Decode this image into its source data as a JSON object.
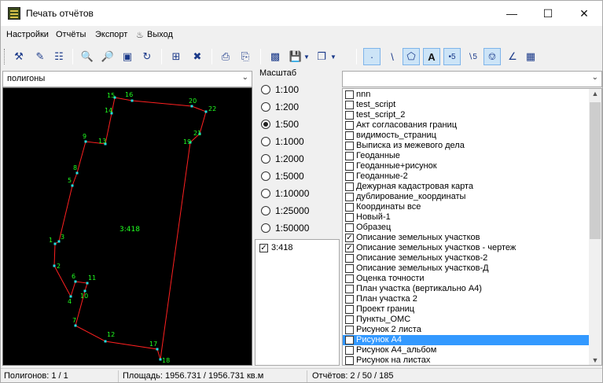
{
  "window": {
    "title": "Печать отчётов"
  },
  "menu": [
    "Настройки",
    "Отчёты",
    "Экспорт",
    "Выход"
  ],
  "layer_combo": {
    "value": "полигоны"
  },
  "map": {
    "polygon_label": "3:418",
    "points": [
      "1",
      "2",
      "3",
      "4",
      "5",
      "6",
      "7",
      "8",
      "9",
      "10",
      "11",
      "12",
      "13",
      "14",
      "15",
      "16",
      "17",
      "18",
      "19",
      "20",
      "21",
      "22"
    ]
  },
  "scale": {
    "title": "Масштаб",
    "options": [
      "1:100",
      "1:200",
      "1:500",
      "1:1000",
      "1:2000",
      "1:5000",
      "1:10000",
      "1:25000",
      "1:50000"
    ],
    "selected": "1:500"
  },
  "objects": [
    {
      "label": "3:418",
      "checked": true
    }
  ],
  "reports": [
    {
      "label": "nnn",
      "checked": false
    },
    {
      "label": "test_script",
      "checked": false
    },
    {
      "label": "test_script_2",
      "checked": false
    },
    {
      "label": "Акт согласования границ",
      "checked": false
    },
    {
      "label": "видимость_страниц",
      "checked": false
    },
    {
      "label": "Выписка из межевого дела",
      "checked": false
    },
    {
      "label": "Геоданные",
      "checked": false
    },
    {
      "label": "Геоданные+рисунок",
      "checked": false
    },
    {
      "label": "Геоданные-2",
      "checked": false
    },
    {
      "label": "Дежурная кадастровая карта",
      "checked": false
    },
    {
      "label": "дублирование_координаты",
      "checked": false
    },
    {
      "label": "Координаты все",
      "checked": false
    },
    {
      "label": "Новый-1",
      "checked": false
    },
    {
      "label": "Образец",
      "checked": false
    },
    {
      "label": "Описание земельных участков",
      "checked": true
    },
    {
      "label": "Описание земельных участков - чертеж",
      "checked": true
    },
    {
      "label": "Описание земельных участков-2",
      "checked": false
    },
    {
      "label": "Описание земельных участков-Д",
      "checked": false
    },
    {
      "label": "Оценка точности",
      "checked": false
    },
    {
      "label": "План участка (вертикально А4)",
      "checked": false
    },
    {
      "label": "План участка 2",
      "checked": false
    },
    {
      "label": "Проект границ",
      "checked": false
    },
    {
      "label": "Пункты_ОМС",
      "checked": false
    },
    {
      "label": "Рисунок 2 листа",
      "checked": false
    },
    {
      "label": "Рисунок А4",
      "checked": false,
      "highlighted": true
    },
    {
      "label": "Рисунок А4_альбом",
      "checked": false
    },
    {
      "label": "Рисунок на листах",
      "checked": false
    }
  ],
  "status": {
    "polygons": "Полигонов: 1 / 1",
    "area": "Площадь: 1956.731 / 1956.731 кв.м",
    "reports": "Отчётов: 2 / 50 / 185"
  },
  "colors": {
    "polygon_line": "#ff2020",
    "vertex": "#20e0e0",
    "label": "#20ff20",
    "highlight": "#3399ff"
  }
}
